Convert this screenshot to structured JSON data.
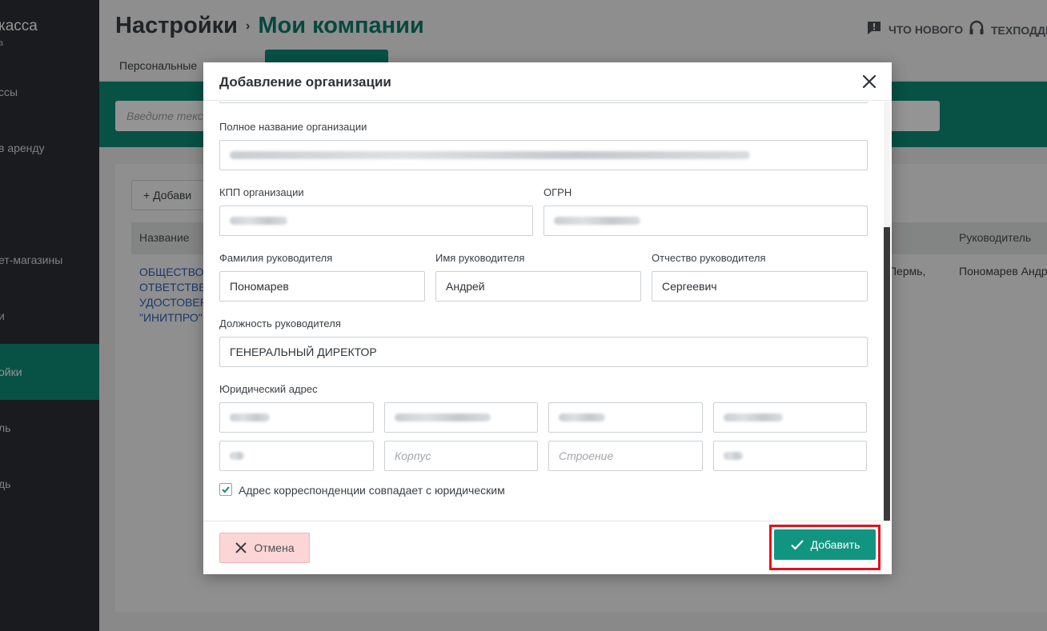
{
  "sidebar": {
    "brand": "касса",
    "brand_sub": "а",
    "items": [
      {
        "label": "ссы"
      },
      {
        "label": "в аренду"
      },
      {
        "label": ""
      },
      {
        "label": "ет-магазины"
      },
      {
        "label": "и"
      },
      {
        "label": "ойки"
      },
      {
        "label": "ль"
      },
      {
        "label": "дь"
      }
    ]
  },
  "header": {
    "title": "Настройки",
    "separator": "›",
    "crumb": "Мои компании",
    "whats_new": "ЧТО НОВОГО",
    "support": "ТЕХПОДДЕ"
  },
  "tabs": {
    "personal": "Персональные"
  },
  "search": {
    "placeholder": "Введите текст"
  },
  "table": {
    "add_button": "+ Добави",
    "headers": {
      "name": "Название",
      "head": "Руководитель"
    },
    "row": {
      "name_lines": [
        "ОБЩЕСТВО",
        "ОТВЕТСТВЕ",
        "УДОСТОВЕР",
        "\"ИНИТПРО\""
      ],
      "city": "г Пермь,",
      "head": "Пономарев Андр"
    }
  },
  "modal": {
    "title": "Добавление организации",
    "full_name_label": "Полное название организации",
    "kpp_label": "КПП организации",
    "ogrn_label": "ОГРН",
    "last_name_label": "Фамилия руководителя",
    "last_name_value": "Пономарев",
    "first_name_label": "Имя руководителя",
    "first_name_value": "Андрей",
    "patronymic_label": "Отчество руководителя",
    "patronymic_value": "Сергеевич",
    "position_label": "Должность руководителя",
    "position_value": "ГЕНЕРАЛЬНЫЙ ДИРЕКТОР",
    "address_label": "Юридический адрес",
    "korpus_placeholder": "Корпус",
    "stroenie_placeholder": "Строение",
    "same_address_label": "Адрес корреспонденции совпадает с юридическим",
    "same_address_checked": true,
    "cancel_label": "Отмена",
    "add_label": "Добавить"
  },
  "colors": {
    "accent": "#0d8c78",
    "sidebar_bg": "#2c3034",
    "link": "#2a64b8",
    "cancel_bg": "#fcd6d6",
    "highlight": "#e0121c"
  }
}
